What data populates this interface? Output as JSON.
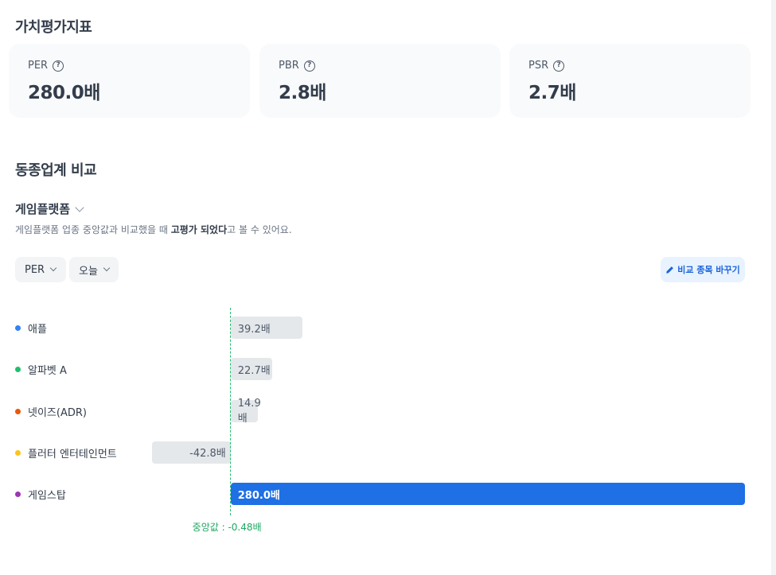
{
  "valuation": {
    "title": "가치평가지표",
    "cards": [
      {
        "label": "PER",
        "value": "280.0배"
      },
      {
        "label": "PBR",
        "value": "2.8배"
      },
      {
        "label": "PSR",
        "value": "2.7배"
      }
    ]
  },
  "peer": {
    "title": "동종업계 비교",
    "sector": "게임플랫폼",
    "desc_pre": "게임플랫폼 업종 중앙값과 비교했을 때 ",
    "desc_bold": "고평가 되었다",
    "desc_post": "고 볼 수 있어요.",
    "metric_filter": "PER",
    "period_filter": "오늘",
    "change_button": "비교 종목 바꾸기"
  },
  "chart_data": {
    "type": "bar",
    "orientation": "horizontal",
    "categories": [
      "애플",
      "알파벳 A",
      "넷이즈(ADR)",
      "플러터 엔터테인먼트",
      "게임스탑"
    ],
    "values": [
      39.2,
      22.7,
      14.9,
      -42.8,
      280.0
    ],
    "value_labels": [
      "39.2배",
      "22.7배",
      "14.9배",
      "-42.8배",
      "280.0배"
    ],
    "colors": [
      "#3182f6",
      "#1fbf6e",
      "#e8590c",
      "#fcc419",
      "#9c36b5"
    ],
    "highlight_color": "#1f6fe5",
    "bar_color": "#e5e8eb",
    "highlight_index": 4,
    "median": -0.48,
    "median_label": "중앙값 : -0.48배",
    "median_color": "#1fbf6e",
    "xlim": [
      -42.8,
      280.0
    ]
  }
}
